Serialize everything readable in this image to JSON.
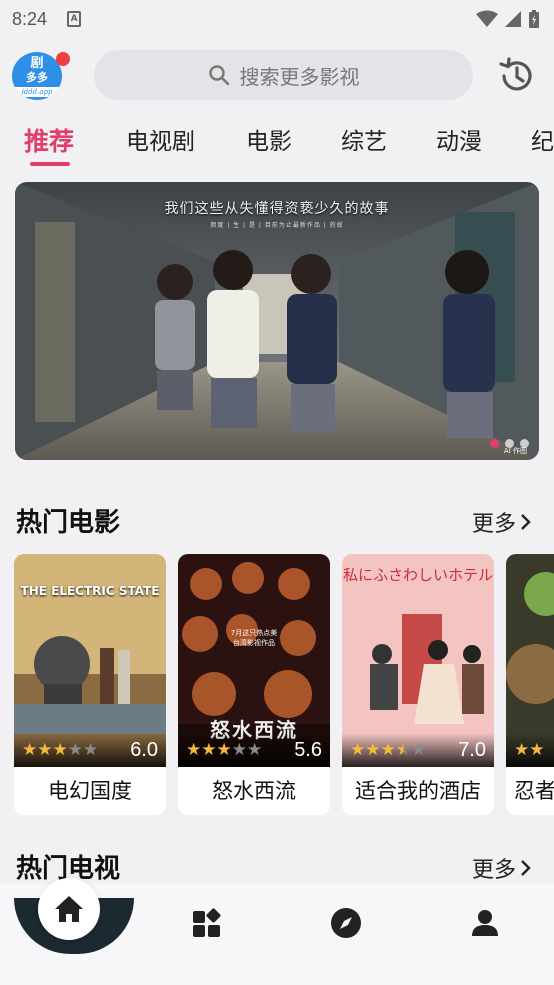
{
  "status_bar": {
    "time": "8:24",
    "notification_icon": "A"
  },
  "header": {
    "logo": {
      "line1": "剧",
      "line2": "多多",
      "line3": "jddd.app"
    },
    "search_placeholder": "搜索更多影视"
  },
  "tabs": [
    {
      "label": "推荐",
      "active": true
    },
    {
      "label": "电视剧"
    },
    {
      "label": "电影"
    },
    {
      "label": "综艺"
    },
    {
      "label": "动漫"
    },
    {
      "label": "纪"
    }
  ],
  "banner": {
    "title": "我们这些从失懂得资亵少久的故事",
    "subtitle": "颜度 | 生 | 是 | 目前为止最新作品 | 的故",
    "tag": "AI 作图",
    "slides": 3,
    "active_slide": 0
  },
  "hot_movies": {
    "title": "热门电影",
    "more_label": "更多",
    "items": [
      {
        "name": "电幻国度",
        "score": "6.0",
        "stars": 3
      },
      {
        "name": "怒水西流",
        "score": "5.6",
        "stars": 3
      },
      {
        "name": "适合我的酒店",
        "score": "7.0",
        "stars": 3.5
      },
      {
        "name": "忍者",
        "score": "",
        "stars": 2
      }
    ]
  },
  "hot_tv": {
    "title": "热门电视",
    "more_label": "更多"
  },
  "poster_text": {
    "p1_title": "THE ELECTRIC STATE",
    "p2_line1": "7月这只热点美",
    "p2_line2": "台湾影视作品",
    "p2_title": "怒水西流",
    "p3_title": "私にふさわしいホテル"
  },
  "colors": {
    "accent": "#e23e6c",
    "star": "#f6b93b",
    "logo": "#2f8fe6"
  }
}
